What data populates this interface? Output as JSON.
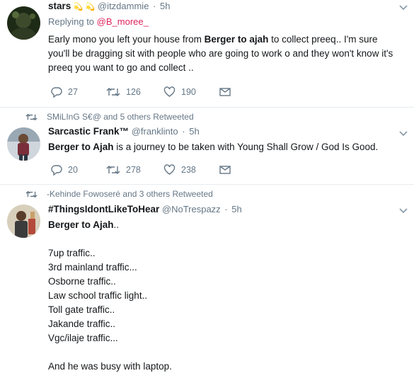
{
  "tweets": [
    {
      "name": "stars",
      "name_emojis": "💫 💫",
      "handle": "@itzdammie",
      "time": "5h",
      "replying_prefix": "Replying to ",
      "replying_to": "@B_moree_",
      "text_a": "Early mono you left your house from ",
      "text_bold": "Berger to ajah",
      "text_b": " to collect preeq.. I'm sure you'll be dragging sit with people who are going to work o and they won't know it's preeq you want to go and collect ..",
      "replies": "27",
      "retweets": "126",
      "likes": "190"
    },
    {
      "retweeted_by": "SMiLInG S€@ and 5 others Retweeted",
      "name": "Sarcastic Frank™",
      "handle": "@franklinto",
      "time": "5h",
      "text_bold": "Berger to Ajah",
      "text_b": " is a journey to be taken with Young Shall Grow / God Is Good.",
      "replies": "20",
      "retweets": "278",
      "likes": "238"
    },
    {
      "retweeted_by": "-Kehinde Fowoseré and 3 others Retweeted",
      "name": "#ThingsIdontLikeToHear",
      "handle": "@NoTrespazz",
      "time": "5h",
      "text_bold": "Berger to Ajah",
      "text_after_bold": "..",
      "lines": [
        "7up traffic..",
        "3rd mainland traffic...",
        "Osborne traffic..",
        "Law school traffic light..",
        "Toll gate traffic..",
        "Jakande traffic..",
        "Vgc/ilaje traffic...",
        "",
        "And he was busy with laptop."
      ]
    }
  ],
  "colors": {
    "text": "#14171a",
    "muted": "#657786",
    "link": "#e0245e",
    "divider": "#e6ecf0"
  }
}
